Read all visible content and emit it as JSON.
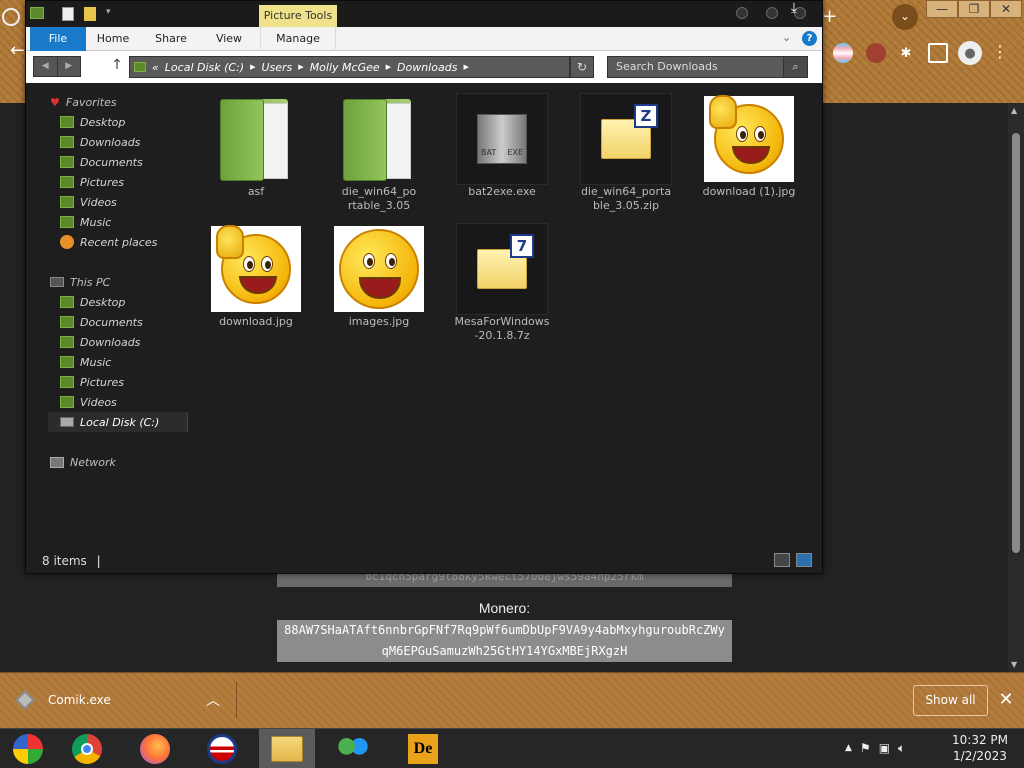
{
  "explorer": {
    "ribbon_context": "Picture Tools",
    "tabs": {
      "file": "File",
      "home": "Home",
      "share": "Share",
      "view": "View",
      "manage": "Manage"
    },
    "address": {
      "prefix": "«",
      "crumbs": [
        "Local Disk (C:)",
        "Users",
        "Molly McGee",
        "Downloads"
      ]
    },
    "search_placeholder": "Search Downloads",
    "nav": {
      "favorites_label": "Favorites",
      "favorites": [
        "Desktop",
        "Downloads",
        "Documents",
        "Pictures",
        "Videos",
        "Music",
        "Recent places"
      ],
      "thispc_label": "This PC",
      "thispc": [
        "Desktop",
        "Documents",
        "Downloads",
        "Music",
        "Pictures",
        "Videos",
        "Local Disk (C:)"
      ],
      "network_label": "Network"
    },
    "files": [
      {
        "name": "asf",
        "kind": "folder"
      },
      {
        "name": "die_win64_portable_3.05",
        "kind": "folder"
      },
      {
        "name": "bat2exe.exe",
        "kind": "exe"
      },
      {
        "name": "die_win64_portable_3.05.zip",
        "kind": "zip"
      },
      {
        "name": "download (1).jpg",
        "kind": "smiley-thumb"
      },
      {
        "name": "download.jpg",
        "kind": "smiley-thumb"
      },
      {
        "name": "images.jpg",
        "kind": "smiley"
      },
      {
        "name": "MesaForWindows-20.1.8.7z",
        "kind": "7z"
      }
    ],
    "status": "8 items"
  },
  "crypto": {
    "btc_partial": "bc1qch5parg9t88ky5kwect5700ejws59a4np25rkm",
    "monero_label": "Monero:",
    "monero_address": "88AW7SHaATAft6nnbrGpFNf7Rq9pWf6umDbUpF9VA9y4abMxyhguroubRcZWyqM6EPGuSamuzWh25GtHY14YGxMBEjRXgzH"
  },
  "download_bar": {
    "file": "Comik.exe",
    "show_all": "Show all"
  },
  "taskbar": {
    "time": "10:32 PM",
    "date": "1/2/2023"
  },
  "colors": {
    "accent": "#1979ca",
    "picture_tools": "#f0e28a",
    "browser_frame": "#b07a38"
  }
}
